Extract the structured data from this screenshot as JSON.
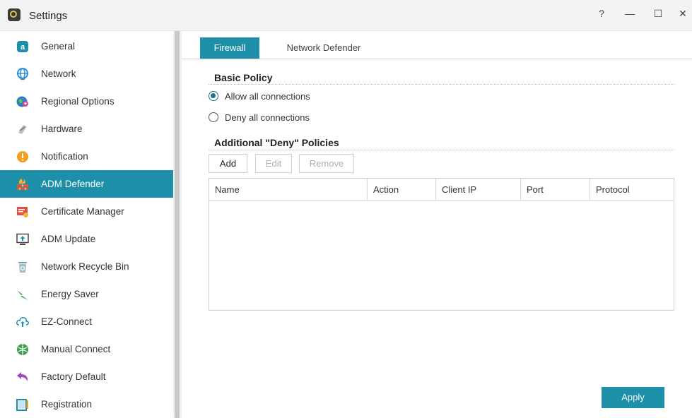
{
  "window": {
    "title": "Settings",
    "help_glyph": "?",
    "min_glyph": "—",
    "max_glyph": "☐",
    "close_glyph": "✕"
  },
  "sidebar": {
    "items": [
      {
        "label": "General",
        "icon": "general-icon",
        "color": "#1d8fa8"
      },
      {
        "label": "Network",
        "icon": "globe-icon",
        "color": "#2a8fd0"
      },
      {
        "label": "Regional Options",
        "icon": "regional-globe-icon",
        "color": "#2b7fc4"
      },
      {
        "label": "Hardware",
        "icon": "hardware-icon",
        "color": "#9aa3ab"
      },
      {
        "label": "Notification",
        "icon": "alert-icon",
        "color": "#f0a020"
      },
      {
        "label": "ADM Defender",
        "icon": "firewall-icon",
        "color": "#e85a2a",
        "active": true
      },
      {
        "label": "Certificate Manager",
        "icon": "certificate-icon",
        "color": "#e34f3f"
      },
      {
        "label": "ADM Update",
        "icon": "update-icon",
        "color": "#1d8fa8"
      },
      {
        "label": "Network Recycle Bin",
        "icon": "recycle-bin-icon",
        "color": "#7aa0b8"
      },
      {
        "label": "Energy Saver",
        "icon": "energy-icon",
        "color": "#3fa33f"
      },
      {
        "label": "EZ-Connect",
        "icon": "cloud-upload-icon",
        "color": "#1d8fa8"
      },
      {
        "label": "Manual Connect",
        "icon": "manual-connect-icon",
        "color": "#36a24a"
      },
      {
        "label": "Factory Default",
        "icon": "undo-arrow-icon",
        "color": "#a04bc0"
      },
      {
        "label": "Registration",
        "icon": "registration-icon",
        "color": "#1d8fa8"
      }
    ]
  },
  "tabs": [
    {
      "label": "Firewall",
      "active": true
    },
    {
      "label": "Network Defender",
      "active": false
    }
  ],
  "basic_policy": {
    "title": "Basic Policy",
    "options": [
      {
        "label": "Allow all connections",
        "checked": true
      },
      {
        "label": "Deny all connections",
        "checked": false
      }
    ]
  },
  "deny_policies": {
    "title": "Additional \"Deny\" Policies",
    "add_label": "Add",
    "edit_label": "Edit",
    "remove_label": "Remove",
    "columns": [
      "Name",
      "Action",
      "Client IP",
      "Port",
      "Protocol"
    ]
  },
  "apply_label": "Apply",
  "colors": {
    "accent": "#1d8fa8",
    "disabled_text": "#b0b0b0"
  }
}
